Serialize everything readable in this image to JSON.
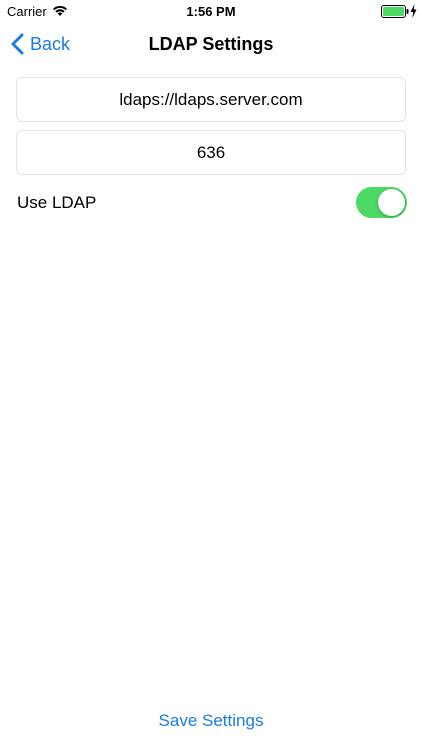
{
  "status_bar": {
    "carrier": "Carrier",
    "time": "1:56 PM",
    "battery_level": 1.0
  },
  "nav": {
    "back_label": "Back",
    "title": "LDAP Settings"
  },
  "form": {
    "server_value": "ldaps://ldaps.server.com",
    "port_value": "636",
    "use_ldap_label": "Use LDAP",
    "use_ldap_on": true
  },
  "save_label": "Save Settings",
  "colors": {
    "accent": "#1a7ce0",
    "switch_on": "#4cd964",
    "battery": "#4cd964",
    "field_border": "#e3e3e3"
  }
}
